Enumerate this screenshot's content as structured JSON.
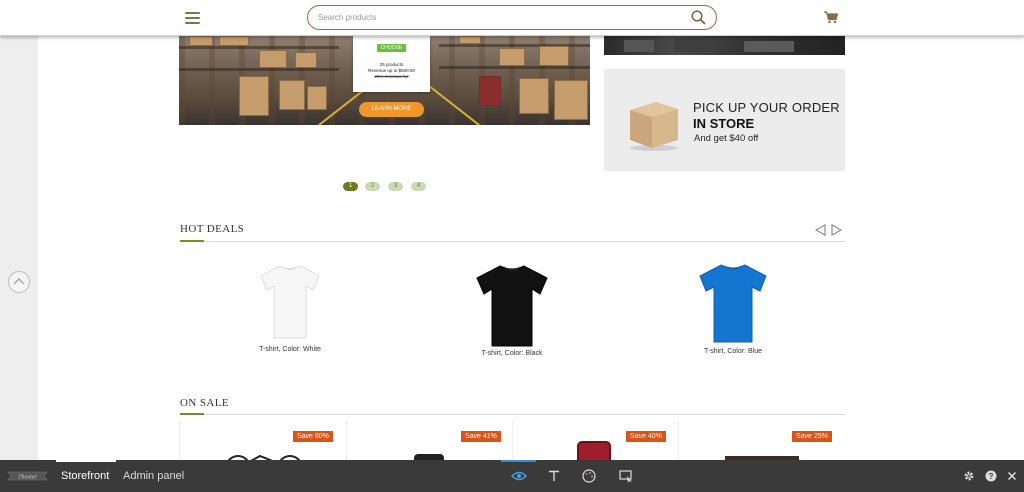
{
  "header": {
    "search_placeholder": "Search products"
  },
  "banner": {
    "choose_label": "CHOOSE",
    "line1": "25 products",
    "line2": "Revenue up to $500.00",
    "line3": "25% Increase for",
    "learn_more": "LEARN MORE"
  },
  "pickup": {
    "title": "PICK UP YOUR ORDER",
    "strong": "IN STORE",
    "sub": "And get $40 off"
  },
  "pagination": [
    "1",
    "2",
    "3",
    "4"
  ],
  "pagination_active": 0,
  "hot_deals": {
    "title": "HOT DEALS",
    "products": [
      {
        "name": "T-shirt, Color: White",
        "color": "#f4f4f4"
      },
      {
        "name": "T-shirt, Color: Black",
        "color": "#111111"
      },
      {
        "name": "T-shirt, Color: Blue",
        "color": "#1476d0"
      }
    ]
  },
  "on_sale": {
    "title": "ON SALE",
    "items": [
      {
        "badge": "Save 80%"
      },
      {
        "badge": "Save 41%"
      },
      {
        "badge": "Save 40%"
      },
      {
        "badge": "Save 25%"
      }
    ]
  },
  "toolbar": {
    "logo_text": "Theater",
    "tab_storefront": "Storefront",
    "tab_admin": "Admin panel"
  },
  "colors": {
    "accent": "#7a8a2a",
    "brand_brown": "#8a6d4a",
    "sale_badge": "#d9541a",
    "button_orange": "#f0962c"
  }
}
